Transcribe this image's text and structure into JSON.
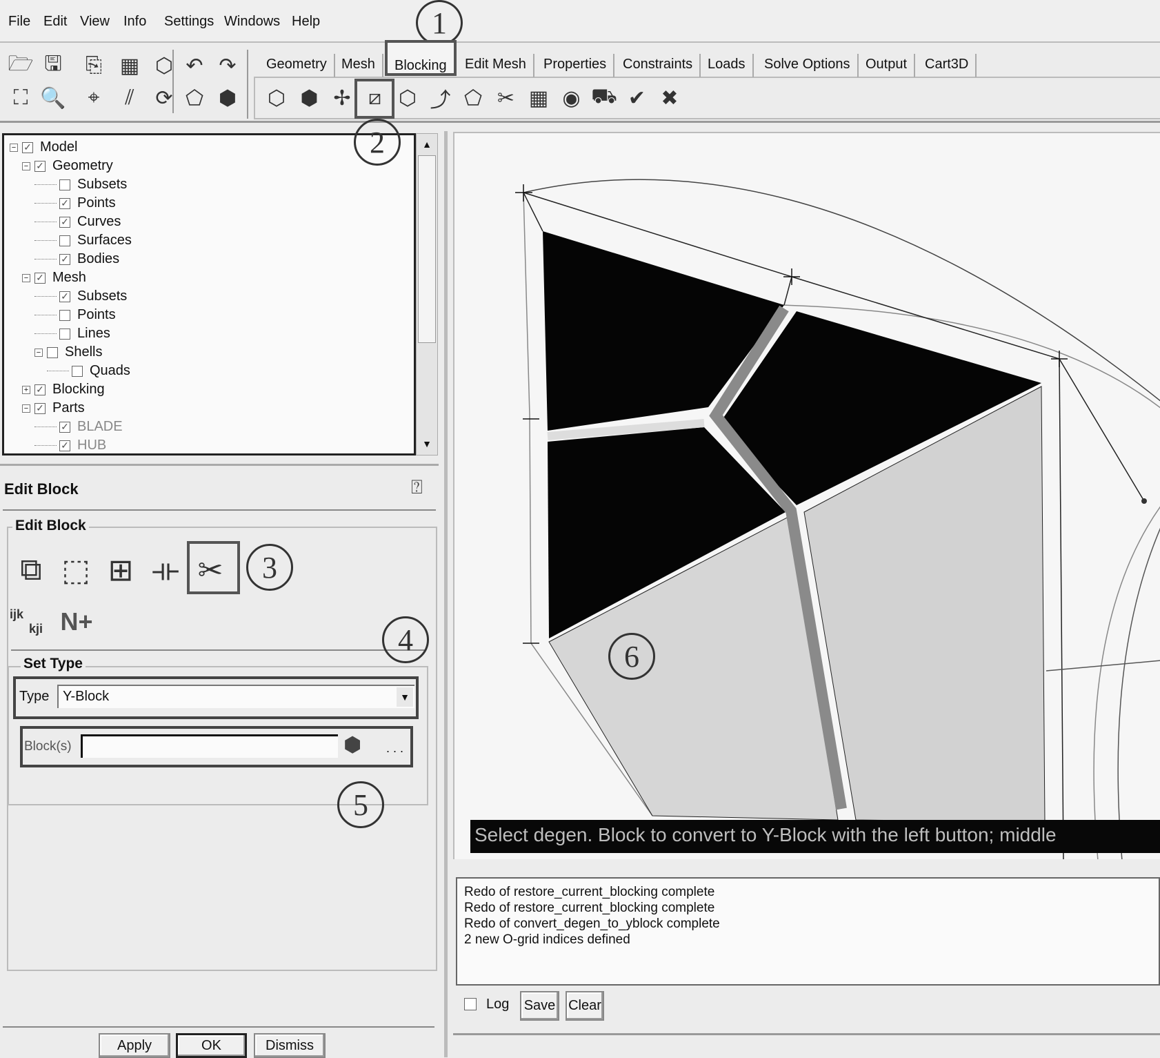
{
  "menu": [
    "File",
    "Edit",
    "View",
    "Info",
    "Settings",
    "Windows",
    "Help"
  ],
  "tabs": [
    "Geometry",
    "Mesh",
    "Blocking",
    "Edit Mesh",
    "Properties",
    "Constraints",
    "Loads",
    "Solve Options",
    "Output",
    "Cart3D"
  ],
  "active_tab": "Blocking",
  "toolbar_left_row1": [
    "open-icon",
    "save-icon",
    "save-as-icon",
    "import-icon",
    "export-icon",
    "undo-icon",
    "redo-icon"
  ],
  "toolbar_left_row2": [
    "fit-window-icon",
    "zoom-box-icon",
    "measure-icon",
    "coordinate-icon",
    "refresh-icon",
    "wireframe-icon",
    "solid-icon"
  ],
  "blocking_tools": [
    "create-block-icon",
    "split-block-icon",
    "associate-icon",
    "edit-block-icon",
    "pre-mesh-params-icon",
    "move-vertex-icon",
    "transform-icon",
    "edit-edge-icon",
    "pre-mesh-icon",
    "quality-icon",
    "extrude-icon",
    "check-icon",
    "delete-icon"
  ],
  "tree": [
    {
      "label": "Model",
      "level": 0,
      "exp": "-",
      "checked": true
    },
    {
      "label": "Geometry",
      "level": 1,
      "exp": "-",
      "checked": true
    },
    {
      "label": "Subsets",
      "level": 2,
      "checked": false
    },
    {
      "label": "Points",
      "level": 2,
      "checked": true
    },
    {
      "label": "Curves",
      "level": 2,
      "checked": true
    },
    {
      "label": "Surfaces",
      "level": 2,
      "checked": false
    },
    {
      "label": "Bodies",
      "level": 2,
      "checked": true
    },
    {
      "label": "Mesh",
      "level": 1,
      "exp": "-",
      "checked": true
    },
    {
      "label": "Subsets",
      "level": 2,
      "checked": true
    },
    {
      "label": "Points",
      "level": 2,
      "checked": false
    },
    {
      "label": "Lines",
      "level": 2,
      "checked": false
    },
    {
      "label": "Shells",
      "level": 2,
      "exp": "-",
      "checked": false
    },
    {
      "label": "Quads",
      "level": 3,
      "checked": false
    },
    {
      "label": "Blocking",
      "level": 1,
      "exp": "+",
      "checked": true
    },
    {
      "label": "Parts",
      "level": 1,
      "exp": "-",
      "checked": true
    },
    {
      "label": "BLADE",
      "level": 2,
      "checked": true,
      "dim": true
    },
    {
      "label": "HUB",
      "level": 2,
      "checked": true,
      "dim": true
    }
  ],
  "panel": {
    "title": "Edit Block",
    "group": "Edit Block",
    "help_icon": "help-icon",
    "tools_row1": [
      "merge-blocks-icon",
      "modify-block-icon",
      "adjust-vertex-icon",
      "move-face-icon",
      "convert-block-type-icon"
    ],
    "tools_row2": [
      "change-ijk-icon",
      "renumber-block-icon"
    ],
    "ijk_label": "ijk",
    "kji_label": "kji",
    "n_plus_label": "N+",
    "set_type": "Set Type",
    "type_label": "Type",
    "type_value": "Y-Block",
    "blocks_label": "Block(s)",
    "blocks_value": "",
    "more": ". . ."
  },
  "buttons": {
    "apply": "Apply",
    "ok": "OK",
    "dismiss": "Dismiss"
  },
  "status": "Select degen. Block to convert to Y-Block with the left button; middle",
  "messages": [
    "Redo of restore_current_blocking complete",
    "Redo of restore_current_blocking complete",
    "Redo of convert_degen_to_yblock complete",
    "2 new O-grid indices defined"
  ],
  "log": {
    "label": "Log",
    "checked": false,
    "save": "Save",
    "clear": "Clear"
  },
  "callouts": [
    "1",
    "2",
    "3",
    "4",
    "5",
    "6"
  ]
}
